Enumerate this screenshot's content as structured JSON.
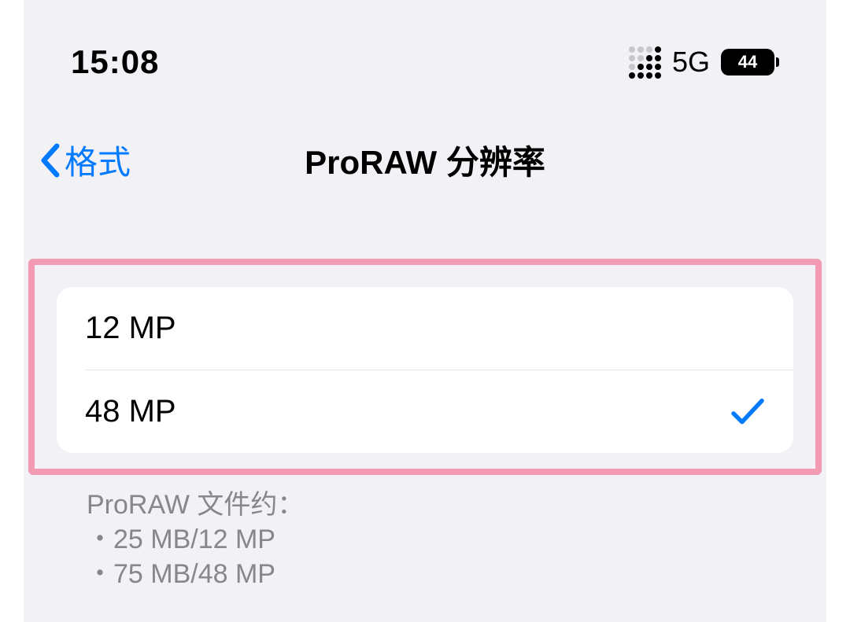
{
  "status": {
    "time": "15:08",
    "network": "5G",
    "battery": "44"
  },
  "nav": {
    "back_label": "格式",
    "title": "ProRAW 分辨率"
  },
  "options": [
    {
      "label": "12 MP",
      "selected": false
    },
    {
      "label": "48 MP",
      "selected": true
    }
  ],
  "footer": {
    "header": "ProRAW 文件约：",
    "lines": [
      "25 MB/12 MP",
      "75 MB/48 MP"
    ]
  }
}
